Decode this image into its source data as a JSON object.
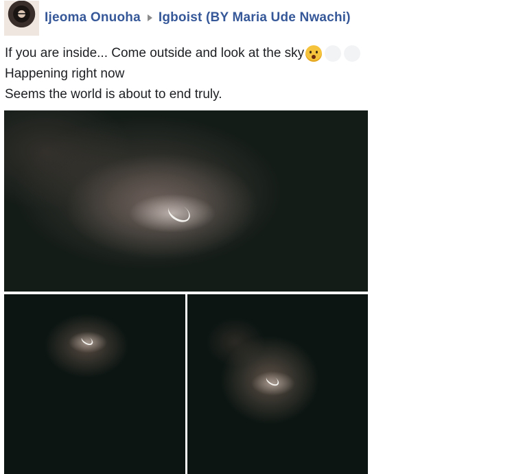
{
  "post": {
    "author": "Ijeoma Onuoha",
    "group": "Igboist (BY Maria Ude Nwachi)",
    "text_lines": [
      "If you are inside... Come outside and look at the sky",
      "Happening right now",
      "Seems the world is about to end truly."
    ]
  },
  "icons": {
    "arrow": "triangle-right-icon",
    "emoji": "frowning-face-open-mouth-emoji"
  },
  "colors": {
    "link_blue": "#365899",
    "text": "#1c1e21",
    "arrow_gray": "#8c8c8c"
  }
}
